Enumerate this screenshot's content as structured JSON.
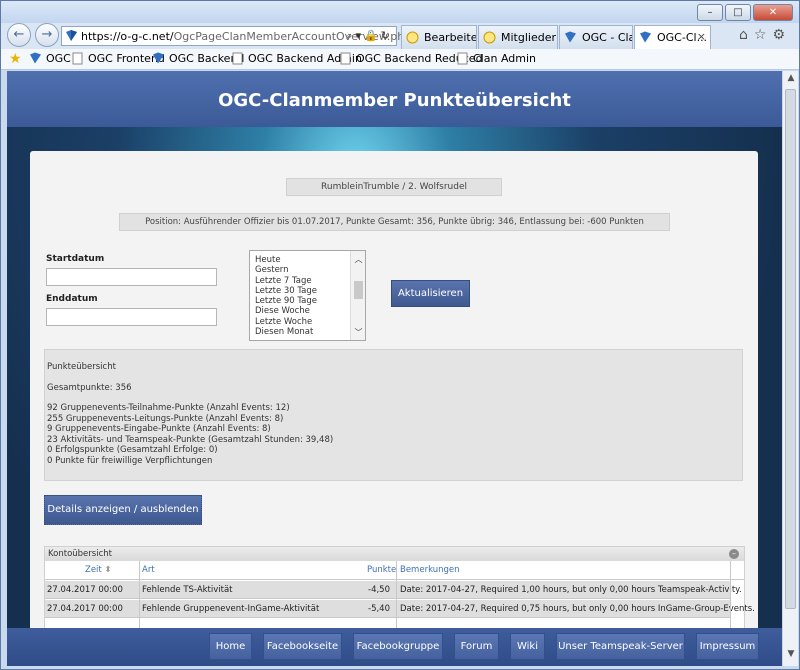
{
  "browser": {
    "url_host": "https://o-g-c.net/",
    "url_path": "OgcPageClanMemberAccountOverview.php?",
    "tabs": [
      {
        "label": "Bearbeiten ..."
      },
      {
        "label": "Mitglieder"
      },
      {
        "label": "OGC - Clan..."
      },
      {
        "label": "OGC-Cl...",
        "close": "×"
      }
    ],
    "favorites": [
      {
        "label": "OGC"
      },
      {
        "label": "OGC Frontend"
      },
      {
        "label": "OGC Backend"
      },
      {
        "label": "OGC Backend Admin"
      },
      {
        "label": "OGC Backend Reduced"
      },
      {
        "label": "Clan Admin"
      }
    ]
  },
  "page": {
    "title": "OGC-Clanmember Punkteübersicht",
    "member": "RumbleinTrumble / 2. Wolfsrudel",
    "position": "Position: Ausführender Offizier bis 01.07.2017, Punkte Gesamt: 356, Punkte übrig: 346, Entlassung bei: -600 Punkten",
    "start_label": "Startdatum",
    "end_label": "Enddatum",
    "range_options": [
      "Heute",
      "Gestern",
      "Letzte 7 Tage",
      "Letzte 30 Tage",
      "Letzte 90 Tage",
      "Diese Woche",
      "Letzte Woche",
      "Diesen Monat"
    ],
    "refresh_button": "Aktualisieren",
    "summary": {
      "title": "Punkteübersicht",
      "total": "Gesamtpunkte: 356",
      "lines": [
        "92 Gruppenevents-Teilnahme-Punkte (Anzahl Events: 12)",
        "255 Gruppenevents-Leitungs-Punkte (Anzahl Events: 8)",
        "9 Gruppenevents-Eingabe-Punkte (Anzahl Events: 8)",
        "23 Aktivitäts- und Teamspeak-Punkte (Gesamtzahl Stunden: 39,48)",
        "0 Erfolgspunkte (Gesamtzahl Erfolge: 0)",
        "0 Punkte für freiwillige Verpflichtungen"
      ]
    },
    "details_button": "Details anzeigen / ausblenden",
    "account": {
      "title": "Kontoübersicht",
      "columns": {
        "zeit": "Zeit",
        "art": "Art",
        "punkte": "Punkte",
        "bemerkungen": "Bemerkungen"
      },
      "rows": [
        {
          "zeit": "27.04.2017 00:00",
          "art": "Fehlende TS-Aktivität",
          "punkte": "-4,50",
          "bemerkungen": "Date: 2017-04-27, Required 1,00 hours, but only 0,00 hours Teamspeak-Activity."
        },
        {
          "zeit": "27.04.2017 00:00",
          "art": "Fehlende Gruppenevent-InGame-Aktivität",
          "punkte": "-5,40",
          "bemerkungen": "Date: 2017-04-27, Required 0,75 hours, but only 0,00 hours InGame-Group-Events."
        }
      ]
    },
    "footer": [
      "Home",
      "Facebookseite",
      "Facebookgruppe",
      "Forum",
      "Wiki",
      "Unser Teamspeak-Server",
      "Impressum"
    ]
  }
}
